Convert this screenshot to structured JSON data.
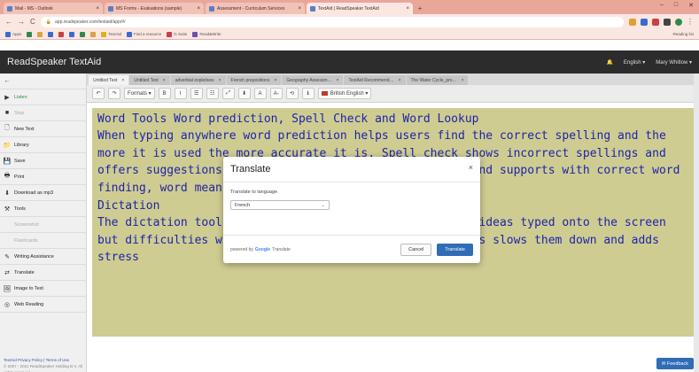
{
  "browser": {
    "tabs": [
      {
        "label": "Mail - MS - Outlook",
        "active": false
      },
      {
        "label": "MS Forms - Evaluations (sample)",
        "active": false
      },
      {
        "label": "Assessment - Curriculum Services",
        "active": false
      },
      {
        "label": "TextAid | ReadSpeaker TextAid",
        "active": true
      }
    ],
    "new_tab": "+",
    "window_controls": [
      "–",
      "□",
      "✕"
    ],
    "url": "app.readspeaker.com/textaid/app/#/",
    "bookmarks": [
      {
        "label": "Apps",
        "color": "#3b6bd0"
      },
      {
        "label": "",
        "color": "#2f8a4a"
      },
      {
        "label": "",
        "color": "#d9a441"
      },
      {
        "label": "",
        "color": "#3b6bd0"
      },
      {
        "label": "",
        "color": "#c94040"
      },
      {
        "label": "",
        "color": "#3b6bd0"
      },
      {
        "label": "",
        "color": "#2f8a4a"
      },
      {
        "label": "",
        "color": "#d9a441"
      },
      {
        "label": "TextAid",
        "color": "#e0b020"
      },
      {
        "label": "Find a resource",
        "color": "#3b6bd0"
      },
      {
        "label": "G Suite",
        "color": "#c94040"
      },
      {
        "label": "Read&Write",
        "color": "#6a4fb0"
      }
    ],
    "bookmarks_right": "Reading list"
  },
  "app": {
    "brand": "ReadSpeaker TextAid",
    "language": "English",
    "user": "Mary Whitlow"
  },
  "sidebar": {
    "items": [
      {
        "label": "Listen",
        "icon": "play-icon",
        "style": "green"
      },
      {
        "label": "Stop",
        "icon": "stop-icon",
        "style": "dim"
      },
      {
        "label": "New Text",
        "icon": "document-icon",
        "style": ""
      },
      {
        "label": "Library",
        "icon": "folder-icon",
        "style": ""
      },
      {
        "label": "Save",
        "icon": "save-icon",
        "style": ""
      },
      {
        "label": "Print",
        "icon": "printer-icon",
        "style": ""
      },
      {
        "label": "Download as mp3",
        "icon": "download-icon",
        "style": ""
      },
      {
        "label": "Tools",
        "icon": "tools-icon",
        "style": ""
      },
      {
        "label": "Screenshot",
        "icon": "",
        "style": "dim"
      },
      {
        "label": "Flashcards",
        "icon": "",
        "style": "dim"
      },
      {
        "label": "Writing Assistance",
        "icon": "pencil-icon",
        "style": ""
      },
      {
        "label": "Translate",
        "icon": "translate-icon",
        "style": ""
      },
      {
        "label": "Image to Text",
        "icon": "image-icon",
        "style": ""
      },
      {
        "label": "Web Reading",
        "icon": "globe-icon",
        "style": ""
      }
    ],
    "footer_links": "TextAid Privacy Policy | Terms of Use",
    "footer_copy": "© 2007 - 2021 ReadSpeaker Holding B.V. All rights reserved."
  },
  "doc_tabs": [
    {
      "label": "Untitled Text",
      "active": true
    },
    {
      "label": "Untitled Text",
      "active": false
    },
    {
      "label": "adverbial expletives",
      "active": false
    },
    {
      "label": "French prepositions",
      "active": false
    },
    {
      "label": "Geography Assessm…",
      "active": false
    },
    {
      "label": "TextAid Recommend…",
      "active": false
    },
    {
      "label": "The Water Cycle_pro…",
      "active": false
    }
  ],
  "toolbar": {
    "buttons": [
      "↶",
      "↷",
      "Formats ▾",
      "B",
      "I",
      "☰",
      "☷",
      "⤢",
      "⬇",
      "A",
      "A-",
      "⟲",
      "ℹ"
    ],
    "language": "British English ▾"
  },
  "editor": {
    "paragraphs": [
      "Word Tools Word prediction, Spell Check and Word Lookup",
      "When typing anywhere word prediction helps users find the correct spelling and the more it is used the more accurate it is. Spell check shows incorrect spellings and offers suggestions and word look up gives definitions and supports with correct word finding, word meaning and spelling difficulties.",
      "Dictation",
      "The dictation tool helps users who need to quickly get ideas typed onto the screen but difficulties with spelling and structuring sentences slows them down and adds stress"
    ]
  },
  "modal": {
    "title": "Translate",
    "close": "×",
    "label": "Translate to language",
    "selected_language": "French",
    "powered_by": "powered by",
    "google": "Google",
    "service": "Translate",
    "cancel": "Cancel",
    "submit": "Translate"
  },
  "feedback": "✉ Feedback"
}
